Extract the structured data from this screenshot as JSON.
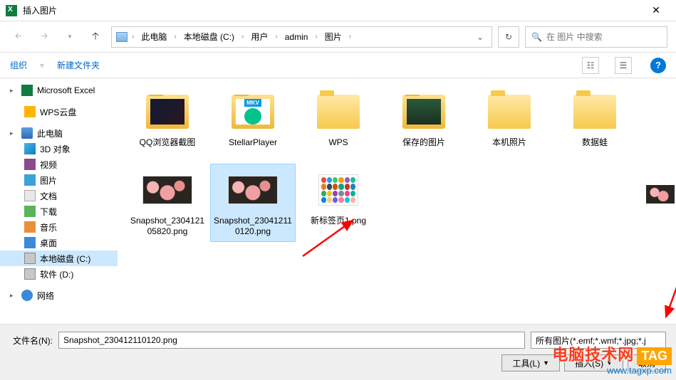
{
  "window": {
    "title": "插入图片"
  },
  "nav": {
    "path": [
      "此电脑",
      "本地磁盘 (C:)",
      "用户",
      "admin",
      "图片"
    ],
    "search_placeholder": "在 图片 中搜索"
  },
  "toolbar": {
    "organize": "组织",
    "new_folder": "新建文件夹"
  },
  "sidebar": {
    "items": [
      {
        "label": "Microsoft Excel",
        "icon": "ic-excel",
        "caret": true
      },
      {
        "label": "WPS云盘",
        "icon": "ic-wps",
        "sub": true
      },
      {
        "label": "此电脑",
        "icon": "ic-pc",
        "caret": true
      },
      {
        "label": "3D 对象",
        "icon": "ic-3d",
        "sub": true
      },
      {
        "label": "视频",
        "icon": "ic-video",
        "sub": true
      },
      {
        "label": "图片",
        "icon": "ic-image",
        "sub": true
      },
      {
        "label": "文档",
        "icon": "ic-doc",
        "sub": true
      },
      {
        "label": "下载",
        "icon": "ic-dl",
        "sub": true
      },
      {
        "label": "音乐",
        "icon": "ic-music",
        "sub": true
      },
      {
        "label": "桌面",
        "icon": "ic-desktop",
        "sub": true
      },
      {
        "label": "本地磁盘 (C:)",
        "icon": "ic-drive",
        "sub": true,
        "active": true
      },
      {
        "label": "软件 (D:)",
        "icon": "ic-drive",
        "sub": true
      },
      {
        "label": "网络",
        "icon": "ic-net",
        "caret": true
      }
    ]
  },
  "files": {
    "row1": [
      {
        "name": "QQ浏览器截图",
        "type": "folder-qq"
      },
      {
        "name": "StellarPlayer",
        "type": "folder-stellar"
      },
      {
        "name": "WPS",
        "type": "folder"
      },
      {
        "name": "保存的图片",
        "type": "folder-save"
      },
      {
        "name": "本机照片",
        "type": "folder"
      },
      {
        "name": "数据蛙",
        "type": "folder"
      }
    ],
    "row2": [
      {
        "name": "Snapshot_230412105820.png",
        "type": "image"
      },
      {
        "name": "Snapshot_230412110120.png",
        "type": "image",
        "selected": true
      },
      {
        "name": "新标签页1.png",
        "type": "icongrid"
      }
    ]
  },
  "footer": {
    "filename_label": "文件名(N):",
    "filename_value": "Snapshot_230412110120.png",
    "filter": "所有图片(*.emf;*.wmf;*.jpg;*.j",
    "tools": "工具(L)",
    "insert": "插入(S)",
    "cancel": "取消"
  },
  "watermark": {
    "text": "电脑技术网",
    "tag": "TAG",
    "url": "www.tagxp.com"
  }
}
